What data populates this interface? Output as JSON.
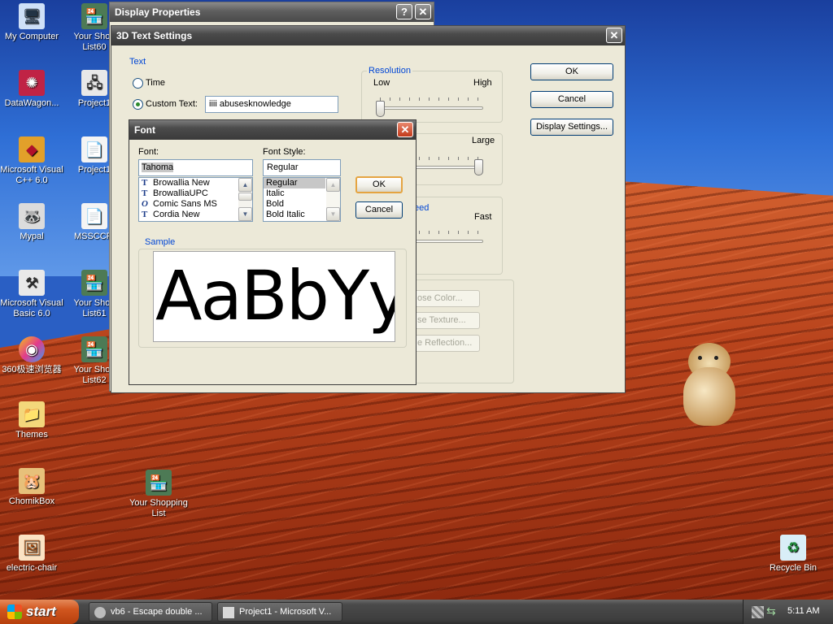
{
  "desktop": {
    "icons": [
      {
        "label": "My Computer",
        "icon": "computer-icon",
        "glyph": "🖥"
      },
      {
        "label": "Your Shop List60",
        "icon": "shop-icon",
        "glyph": "🏪"
      },
      {
        "label": "DataWagon...",
        "icon": "datawagon-icon",
        "glyph": "✺"
      },
      {
        "label": "Project1",
        "icon": "project-icon",
        "glyph": "🖧"
      },
      {
        "label": "Microsoft Visual C++ 6.0",
        "icon": "vcpp-icon",
        "glyph": "◆"
      },
      {
        "label": "Project1",
        "icon": "document-icon",
        "glyph": "📄"
      },
      {
        "label": "Mypal",
        "icon": "mypal-icon",
        "glyph": "🦝"
      },
      {
        "label": "MSSCCPI",
        "icon": "document-icon",
        "glyph": "📄"
      },
      {
        "label": "Microsoft Visual Basic 6.0",
        "icon": "vb6-icon",
        "glyph": "⚒"
      },
      {
        "label": "Your Shop List61",
        "icon": "shop-icon",
        "glyph": "🏪"
      },
      {
        "label": "360极速浏览器",
        "icon": "browser360-icon",
        "glyph": "◉"
      },
      {
        "label": "Your Shop List62",
        "icon": "shop-icon",
        "glyph": "🏪"
      },
      {
        "label": "Themes",
        "icon": "folder-icon",
        "glyph": "📁"
      },
      {
        "label": "ChomikBox",
        "icon": "chomikbox-icon",
        "glyph": "🐹"
      },
      {
        "label": "Your Shopping List",
        "icon": "shop-icon",
        "glyph": "🏪"
      },
      {
        "label": "electric-chair",
        "icon": "image-file-icon",
        "glyph": "🖼"
      },
      {
        "label": "Recycle Bin",
        "icon": "recycle-bin-icon",
        "glyph": "♻"
      }
    ]
  },
  "display_properties": {
    "title": "Display Properties",
    "help_glyph": "?",
    "close_glyph": "✕"
  },
  "text3d": {
    "title": "3D Text Settings",
    "close_glyph": "✕",
    "text_group": "Text",
    "time_label": "Time",
    "custom_text_label": "Custom Text:",
    "custom_text_value": "iiii abusesknowledge",
    "custom_text_selected": true,
    "resolution_group": "Resolution",
    "resolution_low": "Low",
    "resolution_high": "High",
    "resolution_level": 0.0,
    "size_high": "Large",
    "size_level": 1.0,
    "speed_group_partial": "eed",
    "speed_high": "Fast",
    "speed_level": 0.1,
    "ok_label": "OK",
    "cancel_label": "Cancel",
    "display_settings_label": "Display Settings...",
    "choose_color_partial": "ose Color...",
    "choose_texture_partial": "se Texture...",
    "choose_reflection_partial": "e Reflection..."
  },
  "font_dialog": {
    "title": "Font",
    "close_glyph": "✕",
    "font_label": "Font:",
    "font_value": "Tahoma",
    "font_list": [
      {
        "name": "Browallia New",
        "type": "TrueType"
      },
      {
        "name": "BrowalliaUPC",
        "type": "TrueType"
      },
      {
        "name": "Comic Sans MS",
        "type": "OpenType"
      },
      {
        "name": "Cordia New",
        "type": "TrueType"
      }
    ],
    "style_label": "Font Style:",
    "style_value": "Regular",
    "style_list": [
      "Regular",
      "Italic",
      "Bold",
      "Bold Italic"
    ],
    "style_selected": "Regular",
    "ok_label": "OK",
    "cancel_label": "Cancel",
    "sample_label": "Sample",
    "sample_text": "AaBbYy"
  },
  "taskbar": {
    "start_label": "start",
    "tasks": [
      {
        "label": "vb6 - Escape double ...",
        "icon": "vb6-task-icon"
      },
      {
        "label": "Project1 - Microsoft V...",
        "icon": "project-task-icon"
      }
    ],
    "clock": "5:11 AM"
  }
}
